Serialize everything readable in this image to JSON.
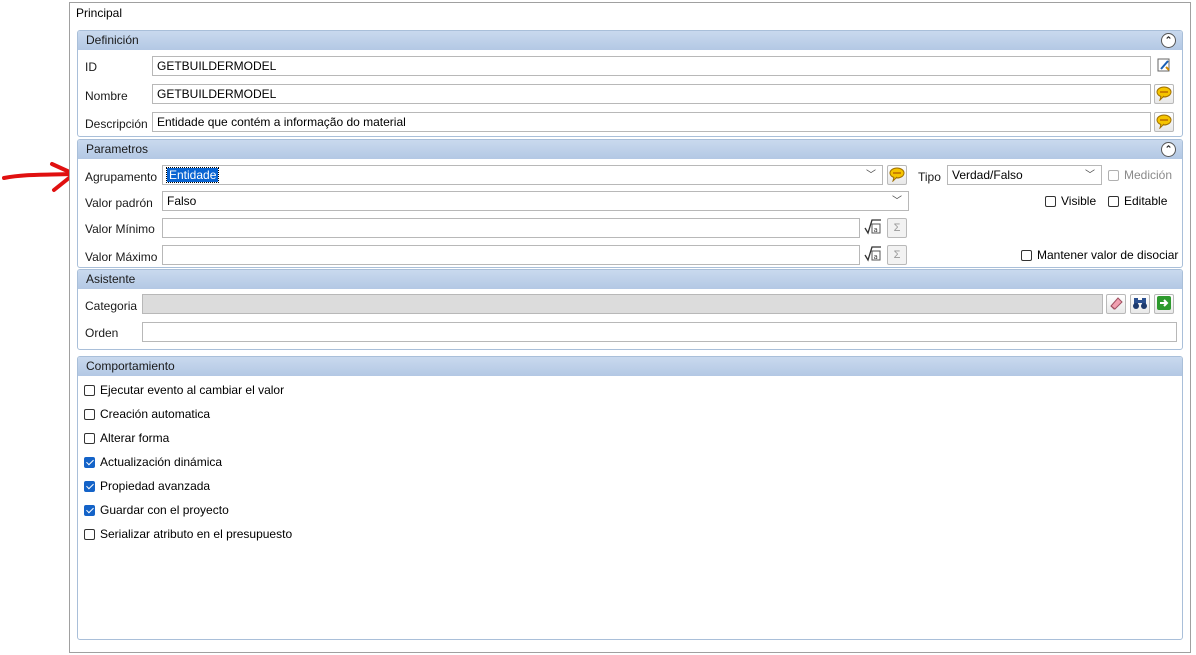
{
  "tab_title": "Principal",
  "definicion": {
    "header": "Definición",
    "id_label": "ID",
    "id_value": "GETBUILDERMODEL",
    "nombre_label": "Nombre",
    "nombre_value": "GETBUILDERMODEL",
    "descripcion_label": "Descripción",
    "descripcion_value": "Entidade que contém a informação do material"
  },
  "parametros": {
    "header": "Parametros",
    "agrupamento_label": "Agrupamento",
    "agrupamento_value": "Entidade",
    "tipo_label": "Tipo",
    "tipo_value": "Verdad/Falso",
    "medicion_label": "Medición",
    "valor_padron_label": "Valor padrón",
    "valor_padron_value": "Falso",
    "visible_label": "Visible",
    "editable_label": "Editable",
    "valor_minimo_label": "Valor Mínimo",
    "valor_maximo_label": "Valor Máximo",
    "mantener_label": "Mantener valor de disociar",
    "sigma_symbol": "Σ"
  },
  "asistente": {
    "header": "Asistente",
    "categoria_label": "Categoria",
    "orden_label": "Orden"
  },
  "comportamiento": {
    "header": "Comportamiento",
    "items": [
      {
        "label": "Ejecutar evento al cambiar el valor",
        "checked": false
      },
      {
        "label": "Creación automatica",
        "checked": false
      },
      {
        "label": "Alterar forma",
        "checked": false
      },
      {
        "label": "Actualización dinámica",
        "checked": true
      },
      {
        "label": "Propiedad avanzada",
        "checked": true
      },
      {
        "label": "Guardar con el proyecto",
        "checked": true
      },
      {
        "label": "Serializar atributo en el presupuesto",
        "checked": false
      }
    ]
  },
  "icons": {
    "collapse": "double-chevron-up-icon",
    "id_tool": "edit-id-icon",
    "translate": "speech-bubble-icon",
    "formula": "formula-icon",
    "sum": "sigma-icon",
    "eraser": "eraser-icon",
    "search": "binoculars-icon",
    "go": "green-arrow-icon",
    "annotation": "red-arrow-icon"
  },
  "colors": {
    "group_header": "#b3c8e4",
    "selection": "#0a64d2",
    "checkbox_on": "#1463c8",
    "annotation_arrow": "#e01010"
  }
}
